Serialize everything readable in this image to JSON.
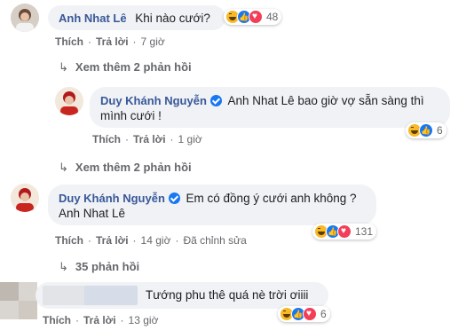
{
  "comments": [
    {
      "author": "Anh Nhat Lê",
      "text": "Khi nào cưới?",
      "reaction_count": "48",
      "actions": {
        "like": "Thích",
        "reply": "Trả lời",
        "time": "7 giờ"
      }
    },
    {
      "author": "Duy Khánh Nguyễn",
      "mention": "Anh Nhat Lê",
      "text_line1": " bao giờ vợ sẵn sàng thì",
      "text_line2": "mình cưới !",
      "reaction_count": "6",
      "actions": {
        "like": "Thích",
        "reply": "Trả lời",
        "time": "1 giờ"
      }
    },
    {
      "author": "Duy Khánh Nguyễn",
      "text": "Em có đồng ý cưới anh không ?",
      "mention": "Anh Nhat Lê",
      "reaction_count": "131",
      "actions": {
        "like": "Thích",
        "reply": "Trả lời",
        "time": "14 giờ",
        "edited": "Đã chỉnh sửa"
      }
    },
    {
      "text": "Tướng phu thê quá nè trời ơiiii",
      "reaction_count": "6",
      "actions": {
        "like": "Thích",
        "reply": "Trả lời",
        "time": "13 giờ"
      }
    }
  ],
  "more_replies": [
    {
      "label": "Xem thêm 2 phản hồi"
    },
    {
      "label": "Xem thêm 2 phản hồi"
    },
    {
      "label": "35 phản hồi"
    }
  ],
  "separator": "·"
}
